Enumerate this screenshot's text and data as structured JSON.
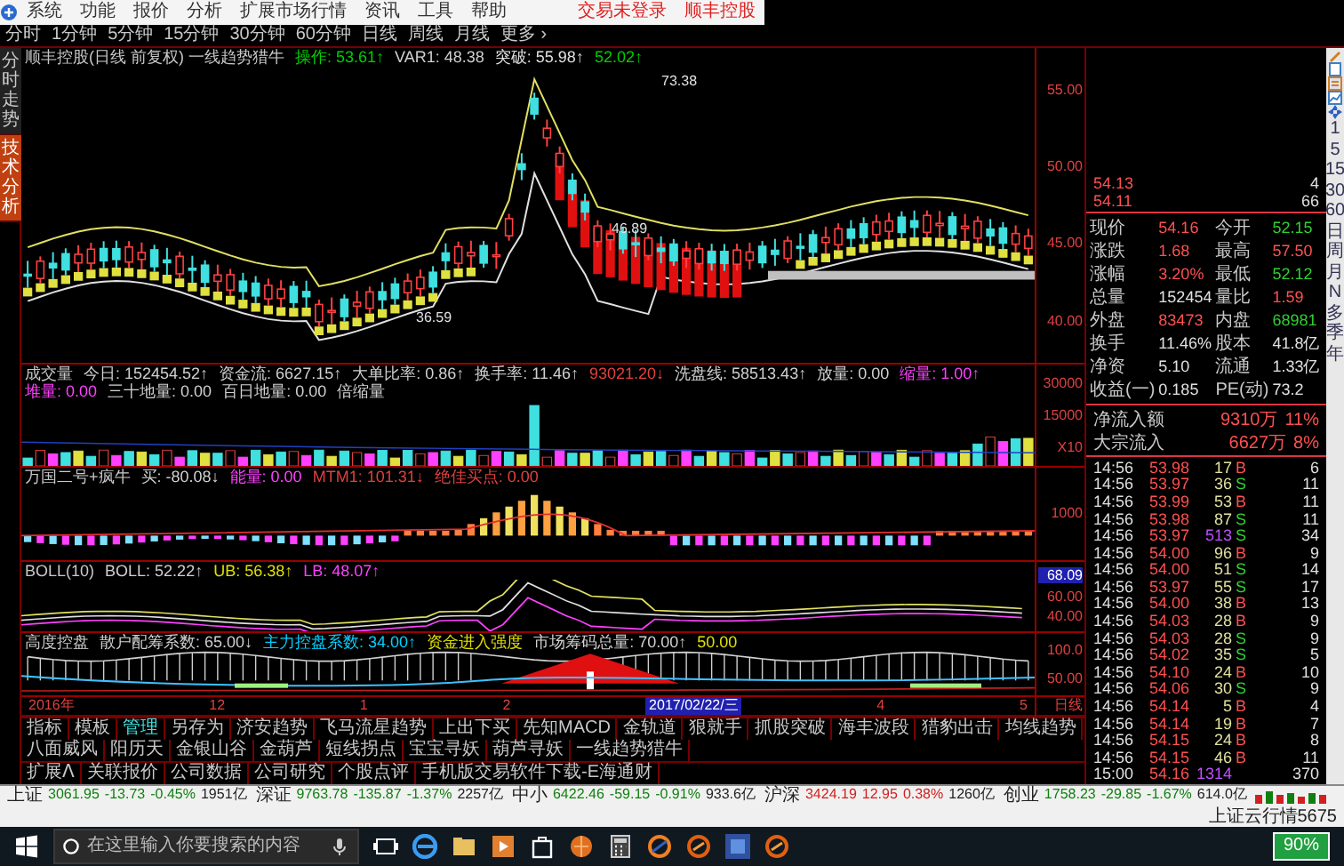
{
  "menu": {
    "items": [
      "系统",
      "功能",
      "报价",
      "分析",
      "扩展市场行情",
      "资讯",
      "工具",
      "帮助"
    ],
    "links": [
      "交易未登录",
      "顺丰控股"
    ]
  },
  "periods": [
    "分时",
    "1分钟",
    "5分钟",
    "15分钟",
    "30分钟",
    "60分钟",
    "日线",
    "周线",
    "月线",
    "更多 ›"
  ],
  "side_tabs": [
    {
      "label": "分时走势",
      "selected": false
    },
    {
      "label": "技术分析",
      "selected": true
    }
  ],
  "panels": [
    {
      "kind": "candles",
      "title": "顺丰控股(日线 前复权) 一线趋势猎牛",
      "readouts": [
        {
          "text": "操作: 53.61↑",
          "color": "#00d000"
        },
        {
          "text": "VAR1: 48.38",
          "color": "#d0d0d0"
        },
        {
          "text": "突破: 55.98↑",
          "color": "#e0e0e0"
        },
        {
          "text": "52.02↑",
          "color": "#00d000"
        }
      ],
      "annotations": [
        "73.38",
        "46.89",
        "36.59"
      ],
      "axis": [
        {
          "text": "55.00",
          "kind": "tick"
        },
        {
          "text": "50.00",
          "kind": "tick"
        },
        {
          "text": "45.00",
          "kind": "tick"
        },
        {
          "text": "40.00",
          "kind": "tick"
        }
      ]
    },
    {
      "kind": "volume",
      "title": "成交量",
      "readouts": [
        {
          "text": "今日: 152454.52↑",
          "color": "#d0d0d0"
        },
        {
          "text": "资金流: 6627.15↑",
          "color": "#d0d0d0"
        },
        {
          "text": "大单比率: 0.86↑",
          "color": "#d0d0d0"
        },
        {
          "text": "换手率: 11.46↑",
          "color": "#d0d0d0"
        },
        {
          "text": "93021.20↓",
          "color": "#e04040"
        },
        {
          "text": "洗盘线: 58513.43↑",
          "color": "#d0d0d0"
        },
        {
          "text": "放量: 0.00",
          "color": "#d0d0d0"
        },
        {
          "text": "缩量: 1.00↑",
          "color": "#ff40ff"
        },
        {
          "text": "堆量: 0.00",
          "color": "#ff40ff"
        },
        {
          "text": "三十地量: 0.00",
          "color": "#d0d0d0"
        },
        {
          "text": "百日地量: 0.00",
          "color": "#d0d0d0"
        },
        {
          "text": "倍缩量",
          "color": "#d0d0d0"
        }
      ],
      "axis": [
        {
          "text": "30000",
          "kind": "tick"
        },
        {
          "text": "15000",
          "kind": "tick"
        },
        {
          "text": "X10",
          "kind": "tick"
        }
      ]
    },
    {
      "kind": "oscillator",
      "title": "万国二号+疯牛",
      "readouts": [
        {
          "text": "买: -80.08↓",
          "color": "#d0d0d0"
        },
        {
          "text": "能量: 0.00",
          "color": "#ff40ff"
        },
        {
          "text": "MTM1: 101.31↓",
          "color": "#e04040"
        },
        {
          "text": "绝佳买点: 0.00",
          "color": "#e04040"
        }
      ],
      "axis": [
        {
          "text": "1000",
          "kind": "tick"
        }
      ]
    },
    {
      "kind": "boll",
      "title": "BOLL(10)",
      "readouts": [
        {
          "text": "BOLL: 52.22↑",
          "color": "#d0d0d0"
        },
        {
          "text": "UB: 56.38↑",
          "color": "#e0e000"
        },
        {
          "text": "LB: 48.07↑",
          "color": "#ff40ff"
        }
      ],
      "axis": [
        {
          "text": "68.09",
          "kind": "cursor"
        },
        {
          "text": "60.00",
          "kind": "tick"
        },
        {
          "text": "40.00",
          "kind": "tick"
        }
      ]
    },
    {
      "kind": "control",
      "title": "高度控盘",
      "readouts": [
        {
          "text": "散户配筹系数: 65.00↓",
          "color": "#d0d0d0"
        },
        {
          "text": "主力控盘系数: 34.00↑",
          "color": "#00d0ff"
        },
        {
          "text": "资金进入强度",
          "color": "#e0e000"
        },
        {
          "text": "市场筹码总量: 70.00↑",
          "color": "#d0d0d0"
        },
        {
          "text": "50.00",
          "color": "#e0e000"
        }
      ],
      "axis": [
        {
          "text": "100.0",
          "kind": "tick"
        },
        {
          "text": "50.00",
          "kind": "tick"
        }
      ]
    }
  ],
  "date_axis": {
    "labels": [
      {
        "text": "2016年",
        "selected": false
      },
      {
        "text": "12",
        "selected": false
      },
      {
        "text": "1",
        "selected": false
      },
      {
        "text": "2",
        "selected": false
      },
      {
        "text": "2017/02/22/三",
        "selected": true
      },
      {
        "text": "4",
        "selected": false
      },
      {
        "text": "5",
        "selected": false
      }
    ],
    "period": "日线"
  },
  "indicator_tabs": [
    {
      "label": "指标",
      "selected": false
    },
    {
      "label": "模板",
      "selected": false
    },
    {
      "label": "管理",
      "selected": true
    },
    {
      "label": "另存为",
      "selected": false
    },
    {
      "label": "济安趋势",
      "selected": false
    },
    {
      "label": "飞马流星趋势",
      "selected": false
    },
    {
      "label": "上出下买",
      "selected": false
    },
    {
      "label": "先知MACD",
      "selected": false
    },
    {
      "label": "金轨道",
      "selected": false
    },
    {
      "label": "狠就手",
      "selected": false
    },
    {
      "label": "抓股突破",
      "selected": false
    },
    {
      "label": "海丰波段",
      "selected": false
    },
    {
      "label": "猎豹出击",
      "selected": false
    },
    {
      "label": "均线趋势",
      "selected": false
    },
    {
      "label": "八面威风",
      "selected": false
    },
    {
      "label": "阳历天",
      "selected": false
    },
    {
      "label": "金银山谷",
      "selected": false
    },
    {
      "label": "金葫芦",
      "selected": false
    },
    {
      "label": "短线拐点",
      "selected": false
    },
    {
      "label": "宝宝寻妖",
      "selected": false
    },
    {
      "label": "葫芦寻妖",
      "selected": false
    },
    {
      "label": "一线趋势猎牛",
      "selected": false
    }
  ],
  "extension_tabs": [
    "扩展ᐱ",
    "关联报价",
    "公司数据",
    "公司研究",
    "个股点评",
    "手机版交易软件下载-E海通财"
  ],
  "order_book": [
    {
      "price": "54.13",
      "volume": "4"
    },
    {
      "price": "54.11",
      "volume": "66"
    }
  ],
  "quote": [
    {
      "label": "现价",
      "value": "54.16",
      "color": "#ff5050"
    },
    {
      "label": "今开",
      "value": "52.15",
      "color": "#30d030"
    },
    {
      "label": "涨跌",
      "value": "1.68",
      "color": "#ff5050"
    },
    {
      "label": "最高",
      "value": "57.50",
      "color": "#ff5050"
    },
    {
      "label": "涨幅",
      "value": "3.20%",
      "color": "#ff5050"
    },
    {
      "label": "最低",
      "value": "52.12",
      "color": "#30d030"
    },
    {
      "label": "总量",
      "value": "152454",
      "color": "#e0e0e0"
    },
    {
      "label": "量比",
      "value": "1.59",
      "color": "#ff5050"
    },
    {
      "label": "外盘",
      "value": "83473",
      "color": "#ff5050"
    },
    {
      "label": "内盘",
      "value": "68981",
      "color": "#30d030"
    },
    {
      "label": "换手",
      "value": "11.46%",
      "color": "#e0e0e0"
    },
    {
      "label": "股本",
      "value": "41.8亿",
      "color": "#e0e0e0"
    },
    {
      "label": "净资",
      "value": "5.10",
      "color": "#e0e0e0"
    },
    {
      "label": "流通",
      "value": "1.33亿",
      "color": "#e0e0e0"
    },
    {
      "label": "收益(一)",
      "value": "0.185",
      "color": "#e0e0e0"
    },
    {
      "label": "PE(动)",
      "value": "73.2",
      "color": "#e0e0e0"
    }
  ],
  "flows": [
    {
      "label": "净流入额",
      "value": "9310万",
      "pct": "11%"
    },
    {
      "label": "大宗流入",
      "value": "6627万",
      "pct": "8%"
    }
  ],
  "trades": [
    {
      "time": "14:56",
      "price": "53.98",
      "volume": "17",
      "side": "B",
      "buy": true,
      "big": false,
      "count": "6"
    },
    {
      "time": "14:56",
      "price": "53.97",
      "volume": "36",
      "side": "S",
      "buy": false,
      "big": false,
      "count": "11"
    },
    {
      "time": "14:56",
      "price": "53.99",
      "volume": "53",
      "side": "B",
      "buy": true,
      "big": false,
      "count": "11"
    },
    {
      "time": "14:56",
      "price": "53.98",
      "volume": "87",
      "side": "S",
      "buy": false,
      "big": false,
      "count": "11"
    },
    {
      "time": "14:56",
      "price": "53.97",
      "volume": "513",
      "side": "S",
      "buy": false,
      "big": true,
      "count": "34"
    },
    {
      "time": "14:56",
      "price": "54.00",
      "volume": "96",
      "side": "B",
      "buy": true,
      "big": false,
      "count": "9"
    },
    {
      "time": "14:56",
      "price": "54.00",
      "volume": "51",
      "side": "S",
      "buy": false,
      "big": false,
      "count": "14"
    },
    {
      "time": "14:56",
      "price": "53.97",
      "volume": "55",
      "side": "S",
      "buy": false,
      "big": false,
      "count": "17"
    },
    {
      "time": "14:56",
      "price": "54.00",
      "volume": "38",
      "side": "B",
      "buy": true,
      "big": false,
      "count": "13"
    },
    {
      "time": "14:56",
      "price": "54.03",
      "volume": "28",
      "side": "B",
      "buy": true,
      "big": false,
      "count": "9"
    },
    {
      "time": "14:56",
      "price": "54.03",
      "volume": "28",
      "side": "S",
      "buy": false,
      "big": false,
      "count": "9"
    },
    {
      "time": "14:56",
      "price": "54.02",
      "volume": "35",
      "side": "S",
      "buy": false,
      "big": false,
      "count": "5"
    },
    {
      "time": "14:56",
      "price": "54.10",
      "volume": "24",
      "side": "B",
      "buy": true,
      "big": false,
      "count": "10"
    },
    {
      "time": "14:56",
      "price": "54.06",
      "volume": "30",
      "side": "S",
      "buy": false,
      "big": false,
      "count": "9"
    },
    {
      "time": "14:56",
      "price": "54.14",
      "volume": "5",
      "side": "B",
      "buy": true,
      "big": false,
      "count": "4"
    },
    {
      "time": "14:56",
      "price": "54.14",
      "volume": "19",
      "side": "B",
      "buy": true,
      "big": false,
      "count": "7"
    },
    {
      "time": "14:56",
      "price": "54.15",
      "volume": "24",
      "side": "B",
      "buy": true,
      "big": false,
      "count": "8"
    },
    {
      "time": "14:56",
      "price": "54.15",
      "volume": "46",
      "side": "B",
      "buy": true,
      "big": false,
      "count": "11"
    },
    {
      "time": "15:00",
      "price": "54.16",
      "volume": "1314",
      "big": true,
      "count": "370"
    }
  ],
  "toolbar_labels": [
    "1",
    "5",
    "15",
    "30",
    "60",
    "日",
    "周",
    "月",
    "N",
    "多",
    "季",
    "年"
  ],
  "ticker": [
    {
      "name": "上证",
      "value": "3061.95",
      "change": "-13.73",
      "pct": "-0.45%",
      "amount": "1951亿",
      "color": "#108010"
    },
    {
      "name": "深证",
      "value": "9763.78",
      "change": "-135.87",
      "pct": "-1.37%",
      "amount": "2257亿",
      "color": "#108010"
    },
    {
      "name": "中小",
      "value": "6422.46",
      "change": "-59.15",
      "pct": "-0.91%",
      "amount": "933.6亿",
      "color": "#108010"
    },
    {
      "name": "沪深",
      "value": "3424.19",
      "change": "12.95",
      "pct": "0.38%",
      "amount": "1260亿",
      "color": "#d02020"
    },
    {
      "name": "创业",
      "value": "1758.23",
      "change": "-29.85",
      "pct": "-1.67%",
      "amount": "614.0亿",
      "color": "#108010"
    }
  ],
  "ticker_service": "上证云行情5675",
  "taskbar": {
    "search": {
      "placeholder": "在这里输入你要搜索的内容"
    },
    "battery": "90%"
  }
}
